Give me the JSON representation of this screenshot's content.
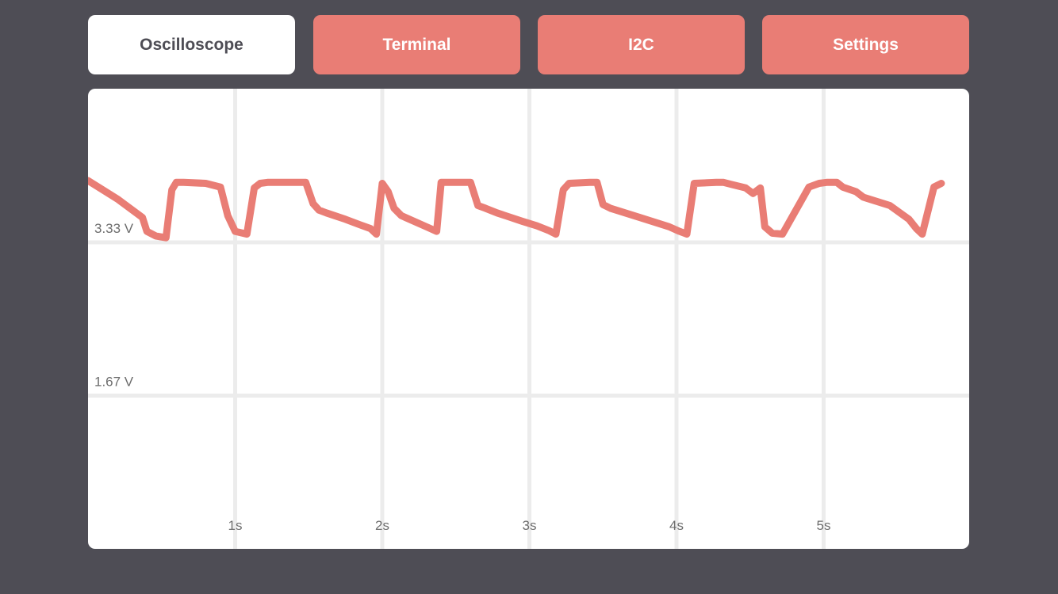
{
  "tabs": [
    {
      "label": "Oscilloscope",
      "active": true
    },
    {
      "label": "Terminal",
      "active": false
    },
    {
      "label": "I2C",
      "active": false
    },
    {
      "label": "Settings",
      "active": false
    }
  ],
  "colors": {
    "background": "#4e4d55",
    "accent": "#e97d75",
    "panel": "#ffffff",
    "grid": "#ececec"
  },
  "chart_data": {
    "type": "line",
    "title": "",
    "xlabel": "",
    "ylabel": "",
    "x_ticks": [
      {
        "value": 1,
        "label": "1s"
      },
      {
        "value": 2,
        "label": "2s"
      },
      {
        "value": 3,
        "label": "3s"
      },
      {
        "value": 4,
        "label": "4s"
      },
      {
        "value": 5,
        "label": "5s"
      }
    ],
    "y_ticks": [
      {
        "value": 3.33,
        "label": "3.33 V"
      },
      {
        "value": 1.67,
        "label": "1.67 V"
      }
    ],
    "xlim": [
      0,
      6
    ],
    "ylim": [
      0,
      5
    ],
    "grid": true,
    "series": [
      {
        "color": "#e97d75",
        "x": [
          0.0,
          0.2,
          0.37,
          0.4,
          0.46,
          0.53,
          0.57,
          0.6,
          0.65,
          0.8,
          0.9,
          0.95,
          1.0,
          1.08,
          1.13,
          1.17,
          1.22,
          1.32,
          1.48,
          1.53,
          1.57,
          1.62,
          1.75,
          1.85,
          1.92,
          1.96,
          2.0,
          2.04,
          2.08,
          2.13,
          2.3,
          2.37,
          2.4,
          2.45,
          2.6,
          2.65,
          2.7,
          2.78,
          2.95,
          3.05,
          3.13,
          3.18,
          3.23,
          3.27,
          3.41,
          3.46,
          3.5,
          3.55,
          3.75,
          3.95,
          4.02,
          4.07,
          4.12,
          4.27,
          4.32,
          4.37,
          4.47,
          4.52,
          4.57,
          4.6,
          4.65,
          4.72,
          4.9,
          4.97,
          5.02,
          5.09,
          5.13,
          5.22,
          5.27,
          5.45,
          5.58,
          5.63,
          5.67,
          5.75,
          5.8
        ],
        "y": [
          4.0,
          3.8,
          3.6,
          3.45,
          3.4,
          3.38,
          3.9,
          3.98,
          3.98,
          3.97,
          3.93,
          3.62,
          3.45,
          3.42,
          3.92,
          3.97,
          3.98,
          3.98,
          3.98,
          3.75,
          3.68,
          3.65,
          3.58,
          3.52,
          3.48,
          3.42,
          3.97,
          3.88,
          3.7,
          3.62,
          3.5,
          3.45,
          3.98,
          3.98,
          3.98,
          3.73,
          3.7,
          3.65,
          3.56,
          3.51,
          3.46,
          3.42,
          3.9,
          3.97,
          3.98,
          3.98,
          3.74,
          3.7,
          3.6,
          3.5,
          3.45,
          3.42,
          3.97,
          3.98,
          3.98,
          3.96,
          3.92,
          3.86,
          3.92,
          3.5,
          3.43,
          3.42,
          3.93,
          3.97,
          3.98,
          3.98,
          3.93,
          3.88,
          3.82,
          3.73,
          3.58,
          3.48,
          3.42,
          3.93,
          3.97
        ]
      }
    ]
  }
}
